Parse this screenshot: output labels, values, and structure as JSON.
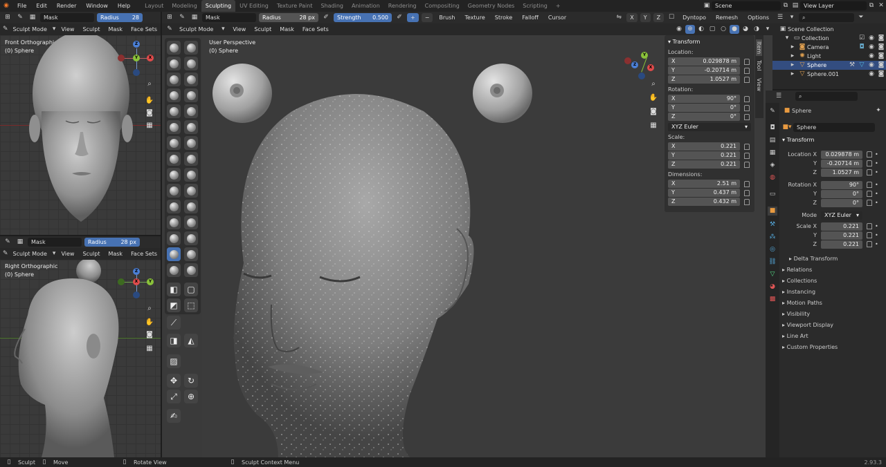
{
  "menu": [
    "File",
    "Edit",
    "Render",
    "Window",
    "Help"
  ],
  "workspaces": [
    "Layout",
    "Modeling",
    "Sculpting",
    "UV Editing",
    "Texture Paint",
    "Shading",
    "Animation",
    "Rendering",
    "Compositing",
    "Geometry Nodes",
    "Scripting"
  ],
  "active_workspace": "Sculpting",
  "scene": "Scene",
  "view_layer": "View Layer",
  "toolheader": {
    "brush": "Mask",
    "radius_label": "Radius",
    "radius_value": "28 px",
    "strength_label": "Strength",
    "strength_value": "0.500",
    "menus": [
      "Brush",
      "Texture",
      "Stroke",
      "Falloff",
      "Cursor"
    ],
    "axes": [
      "X",
      "Y",
      "Z"
    ],
    "dyntopo": "Dyntopo",
    "remesh": "Remesh",
    "options": "Options"
  },
  "left_top_header": {
    "brush": "Mask",
    "radius_label": "Radius",
    "radius_value": "28"
  },
  "mode_menu": {
    "mode": "Sculpt Mode",
    "items": [
      "View",
      "Sculpt",
      "Mask",
      "Face Sets"
    ]
  },
  "vp_front": {
    "title": "Front Orthographic",
    "object": "(0) Sphere"
  },
  "vp_right": {
    "title": "Right Orthographic",
    "object": "(0) Sphere"
  },
  "vp_main": {
    "title": "User Perspective",
    "object": "(0) Sphere"
  },
  "left_bottom_header": {
    "brush": "Mask",
    "radius_label": "Radius",
    "radius_value": "28 px"
  },
  "npanel": {
    "title": "Transform",
    "location_label": "Location:",
    "location": [
      [
        "X",
        "0.029878 m"
      ],
      [
        "Y",
        "-0.20714 m"
      ],
      [
        "Z",
        "1.0527 m"
      ]
    ],
    "rotation_label": "Rotation:",
    "rotation": [
      [
        "X",
        "90°"
      ],
      [
        "Y",
        "0°"
      ],
      [
        "Z",
        "0°"
      ]
    ],
    "rotation_mode": "XYZ Euler",
    "scale_label": "Scale:",
    "scale": [
      [
        "X",
        "0.221"
      ],
      [
        "Y",
        "0.221"
      ],
      [
        "Z",
        "0.221"
      ]
    ],
    "dimensions_label": "Dimensions:",
    "dimensions": [
      [
        "X",
        "2.51 m"
      ],
      [
        "Y",
        "0.437 m"
      ],
      [
        "Z",
        "0.432 m"
      ]
    ],
    "tabs": [
      "Item",
      "Tool",
      "View"
    ]
  },
  "outliner": {
    "scene_collection": "Scene Collection",
    "collection": "Collection",
    "items": [
      "Camera",
      "Light",
      "Sphere",
      "Sphere.001"
    ]
  },
  "properties": {
    "object": "Sphere",
    "object_field": "Sphere",
    "transform": "Transform",
    "location": [
      [
        "Location X",
        "0.029878 m"
      ],
      [
        "Y",
        "-0.20714 m"
      ],
      [
        "Z",
        "1.0527 m"
      ]
    ],
    "rotation": [
      [
        "Rotation X",
        "90°"
      ],
      [
        "Y",
        "0°"
      ],
      [
        "Z",
        "0°"
      ]
    ],
    "mode_label": "Mode",
    "mode_value": "XYZ Euler",
    "scale": [
      [
        "Scale X",
        "0.221"
      ],
      [
        "Y",
        "0.221"
      ],
      [
        "Z",
        "0.221"
      ]
    ],
    "delta": "Delta Transform",
    "sections": [
      "Relations",
      "Collections",
      "Instancing",
      "Motion Paths",
      "Visibility",
      "Viewport Display",
      "Line Art",
      "Custom Properties"
    ]
  },
  "statusbar": {
    "items": [
      "Sculpt",
      "Move",
      "Rotate View",
      "Sculpt Context Menu"
    ],
    "version": "2.93.3"
  },
  "colors": {
    "accent": "#4772b3",
    "header": "#2b2b2b",
    "viewport": "#3a3a3a",
    "panel": "#303030"
  }
}
